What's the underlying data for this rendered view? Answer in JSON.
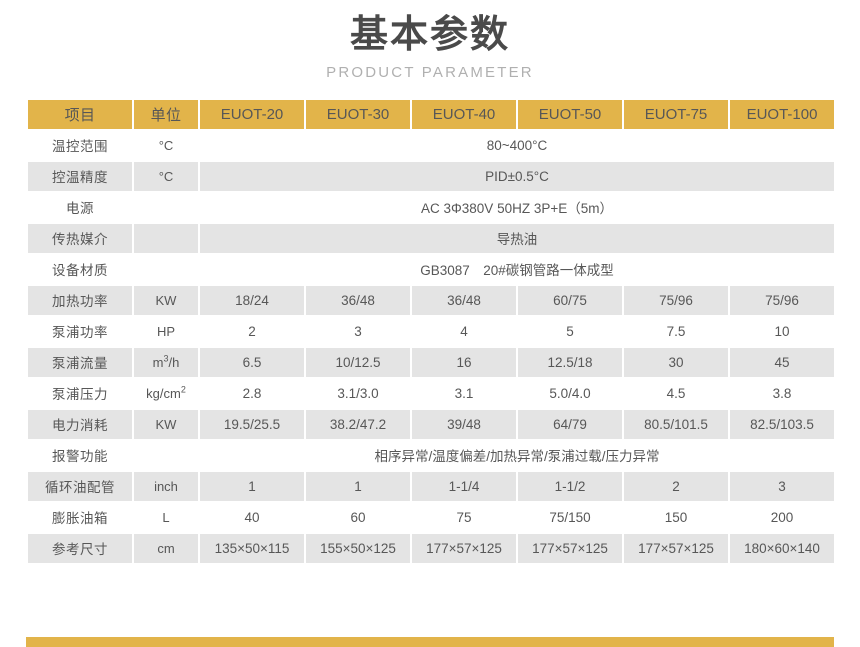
{
  "header": {
    "title": "基本参数",
    "subtitle": "PRODUCT PARAMETER"
  },
  "colors": {
    "accent": "#e2b44a",
    "row_shade": "#e4e4e4",
    "text": "#575757",
    "title": "#4a4a4a",
    "subtitle": "#b0b0b0"
  },
  "table": {
    "columns": [
      {
        "key": "item",
        "label": "项目"
      },
      {
        "key": "unit",
        "label": "单位"
      },
      {
        "key": "m20",
        "label": "EUOT-20"
      },
      {
        "key": "m30",
        "label": "EUOT-30"
      },
      {
        "key": "m40",
        "label": "EUOT-40"
      },
      {
        "key": "m50",
        "label": "EUOT-50"
      },
      {
        "key": "m75",
        "label": "EUOT-75"
      },
      {
        "key": "m100",
        "label": "EUOT-100"
      }
    ],
    "rows": [
      {
        "item": "温控范围",
        "unit": "°C",
        "merged": true,
        "merged_value": "80~400°C",
        "shaded": false
      },
      {
        "item": "控温精度",
        "unit": "°C",
        "merged": true,
        "merged_value": "PID±0.5°C",
        "shaded": true
      },
      {
        "item": "电源",
        "unit": "",
        "merged": true,
        "merged_value": "AC 3Φ380V 50HZ 3P+E（5m）",
        "shaded": false
      },
      {
        "item": "传热媒介",
        "unit": "",
        "merged": true,
        "merged_value": "导热油",
        "shaded": true
      },
      {
        "item": "设备材质",
        "unit": "",
        "merged": true,
        "merged_value": "GB3087　20#碳钢管路一体成型",
        "shaded": false
      },
      {
        "item": "加热功率",
        "unit": "KW",
        "merged": false,
        "values": [
          "18/24",
          "36/48",
          "36/48",
          "60/75",
          "75/96",
          "75/96"
        ],
        "shaded": true
      },
      {
        "item": "泵浦功率",
        "unit": "HP",
        "merged": false,
        "values": [
          "2",
          "3",
          "4",
          "5",
          "7.5",
          "10"
        ],
        "shaded": false
      },
      {
        "item": "泵浦流量",
        "unit": "m³/h",
        "unit_html": "m<sup>3</sup>/h",
        "merged": false,
        "values": [
          "6.5",
          "10/12.5",
          "16",
          "12.5/18",
          "30",
          "45"
        ],
        "shaded": true
      },
      {
        "item": "泵浦压力",
        "unit": "kg/cm²",
        "unit_html": "kg/cm<sup>2</sup>",
        "merged": false,
        "values": [
          "2.8",
          "3.1/3.0",
          "3.1",
          "5.0/4.0",
          "4.5",
          "3.8"
        ],
        "shaded": false
      },
      {
        "item": "电力消耗",
        "unit": "KW",
        "merged": false,
        "values": [
          "19.5/25.5",
          "38.2/47.2",
          "39/48",
          "64/79",
          "80.5/101.5",
          "82.5/103.5"
        ],
        "shaded": true
      },
      {
        "item": "报警功能",
        "unit": "",
        "merged": true,
        "merged_value": "相序异常/温度偏差/加热异常/泵浦过载/压力异常",
        "shaded": false
      },
      {
        "item": "循环油配管",
        "unit": "inch",
        "merged": false,
        "values": [
          "1",
          "1",
          "1-1/4",
          "1-1/2",
          "2",
          "3"
        ],
        "shaded": true
      },
      {
        "item": "膨胀油箱",
        "unit": "L",
        "merged": false,
        "values": [
          "40",
          "60",
          "75",
          "75/150",
          "150",
          "200"
        ],
        "shaded": false
      },
      {
        "item": "参考尺寸",
        "unit": "cm",
        "merged": false,
        "values": [
          "135×50×115",
          "155×50×125",
          "177×57×125",
          "177×57×125",
          "177×57×125",
          "180×60×140"
        ],
        "shaded": true
      }
    ]
  },
  "footer": {
    "bar_color": "#e2b44a"
  }
}
